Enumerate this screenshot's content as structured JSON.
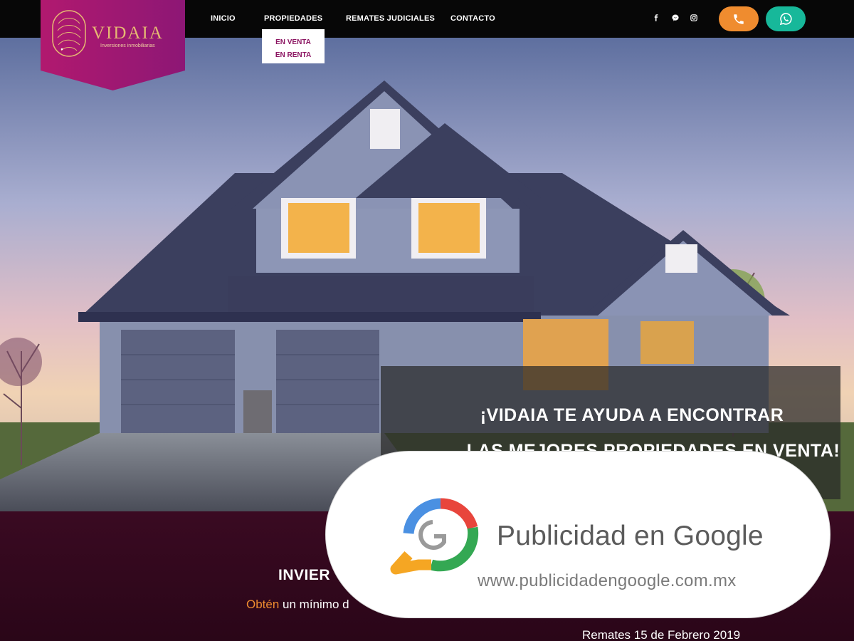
{
  "brand": {
    "name": "VIDAIA",
    "tagline": "Inversiones inmobiliarias"
  },
  "nav": {
    "items": [
      "INICIO",
      "PROPIEDADES",
      "REMATES JUDICIALES",
      "CONTACTO"
    ],
    "dropdown": [
      "EN VENTA",
      "EN RENTA"
    ]
  },
  "social": {
    "icons": [
      "facebook-icon",
      "messenger-icon",
      "instagram-icon"
    ]
  },
  "actions": {
    "phone_icon": "phone-icon",
    "whatsapp_icon": "whatsapp-icon",
    "phone_color": "#ef8c2f",
    "whatsapp_color": "#17b89a"
  },
  "hero": {
    "line1": "¡VIDAIA TE AYUDA A ENCONTRAR",
    "line2": "LAS MEJORES PROPIEDADES EN VENTA!"
  },
  "section": {
    "heading_partial": "INVIER",
    "subtext_highlight": "Obtén",
    "subtext_rest": " un mínimo d",
    "remates": "Remates 15 de Febrero 2019"
  },
  "ad": {
    "title": "Publicidad en Google",
    "url": "www.publicidadengoogle.com.mx"
  },
  "colors": {
    "brand": "#a0186f",
    "accent": "#e5b872",
    "footer_bg": "#2a0618"
  }
}
